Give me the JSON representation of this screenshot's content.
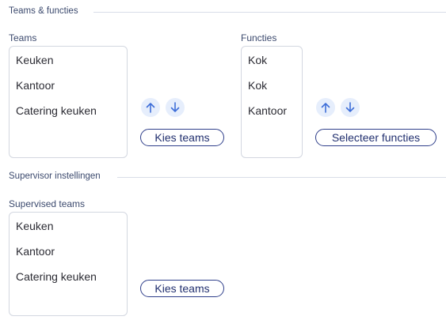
{
  "sections": {
    "teams_functions_title": "Teams & functies",
    "supervisor_title": "Supervisor instellingen"
  },
  "teams": {
    "label": "Teams",
    "items": [
      "Keuken",
      "Kantoor",
      "Catering keuken"
    ],
    "button": "Kies teams"
  },
  "functions": {
    "label": "Functies",
    "items": [
      "Kok",
      "Kok",
      "Kantoor"
    ],
    "button": "Selecteer functies"
  },
  "supervised": {
    "label": "Supervised teams",
    "items": [
      "Keuken",
      "Kantoor",
      "Catering keuken"
    ],
    "button": "Kies teams"
  },
  "icons": {
    "up": "arrow-up-icon",
    "down": "arrow-down-icon"
  },
  "colors": {
    "accent": "#2e3e8a",
    "icon_bg": "#e6eefc",
    "icon": "#3f6fd8"
  }
}
